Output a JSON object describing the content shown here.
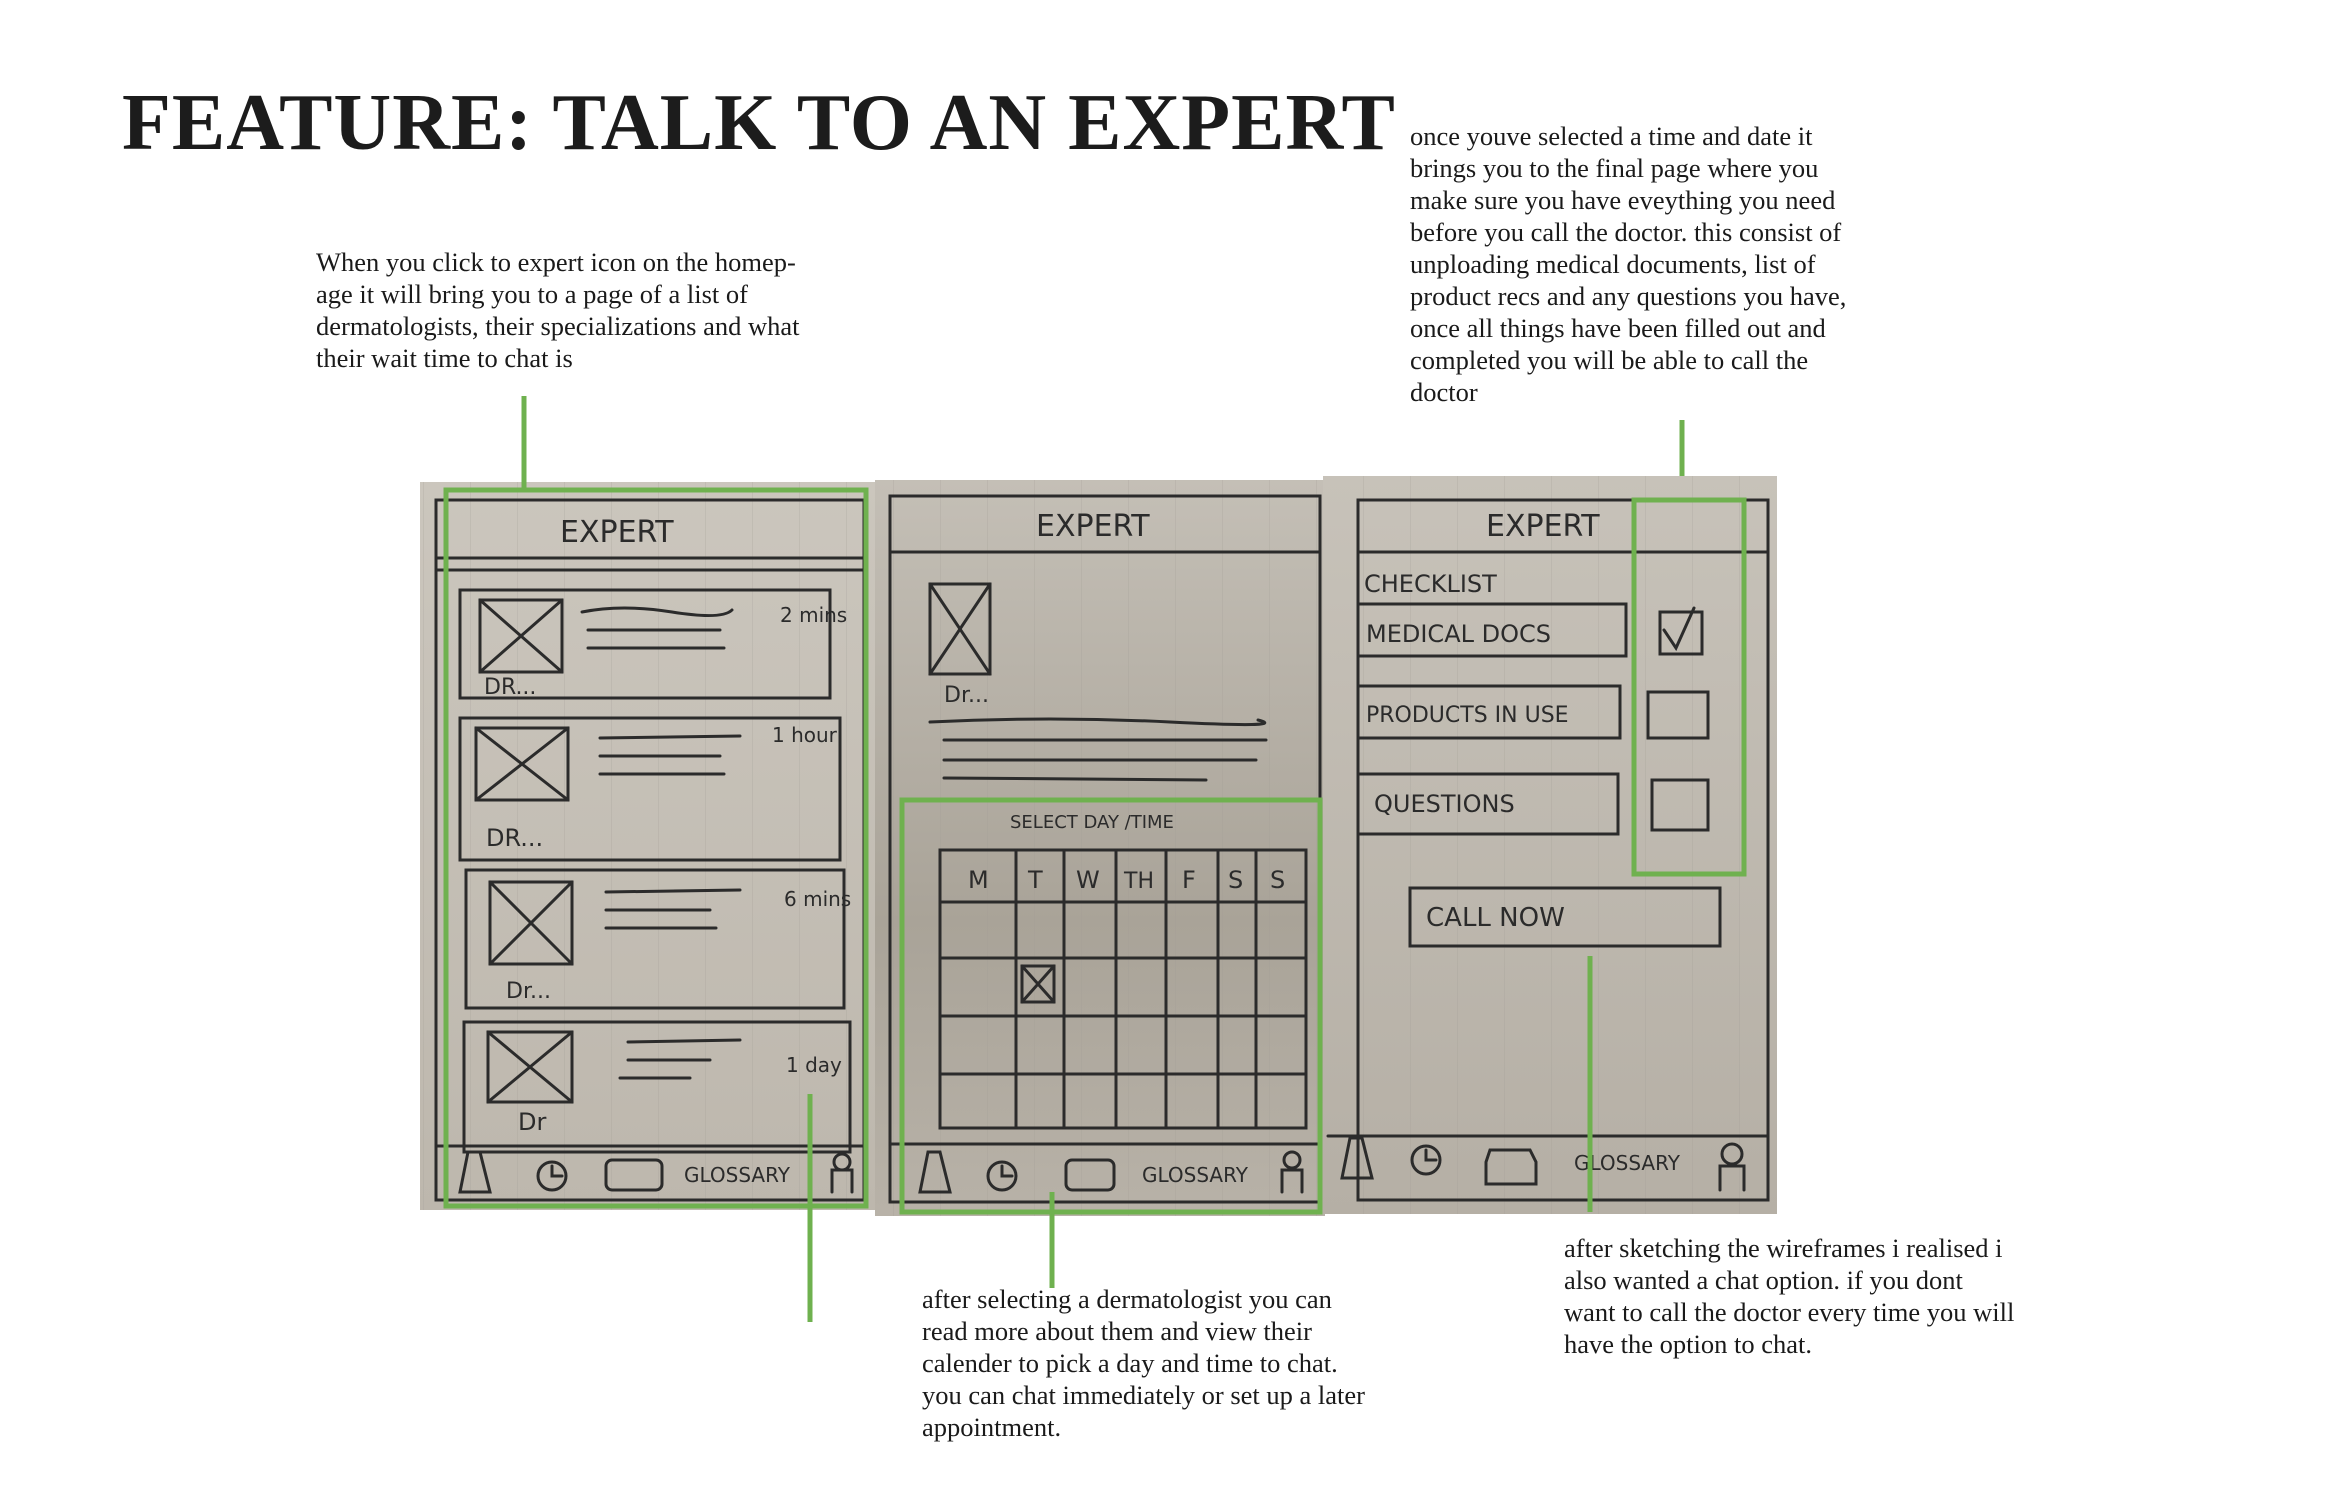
{
  "page": {
    "title": "FEATURE: TALK TO AN EXPERT"
  },
  "notes": {
    "homepage": [
      "When you click to expert icon on the homep-",
      "age it will bring you to a page of a list of",
      "dermatologists, their specializations and what",
      "their wait time to chat is"
    ],
    "checklist": [
      "once youve selected a time and date it",
      "brings you to the final page where  you",
      "make sure you have eveything you need",
      "before you call the doctor. this consist of",
      "unploading medical documents, list of",
      "product recs and any questions you have,",
      "once all things have been filled out and",
      "completed you will be able to call the",
      "doctor"
    ],
    "calendar": [
      "after selecting a dermatologist you can",
      "read more about them and view their",
      "calender to pick a day and time to chat.",
      "you can chat immediately or set up a later",
      "appointment."
    ],
    "chat": [
      "after sketching the wireframes i realised i",
      "also wanted a chat option. if you dont",
      "want to call the doctor every time you will",
      "have the option to chat."
    ]
  },
  "sketch_list": {
    "header": "EXPERT",
    "items": [
      {
        "doctor": "DR...",
        "wait": "2 mins"
      },
      {
        "doctor": "DR...",
        "wait": "1 hour"
      },
      {
        "doctor": "Dr...",
        "wait": "6 mins"
      },
      {
        "doctor": "Dr",
        "wait": "1 day"
      }
    ]
  },
  "sketch_profile": {
    "header": "EXPERT",
    "doctor": "Dr...",
    "picker_label": "SELECT DAY /TIME",
    "days": [
      "M",
      "T",
      "W",
      "TH",
      "F",
      "S",
      "S"
    ]
  },
  "sketch_checklist": {
    "header": "EXPERT",
    "checklist_label": "CHECKLIST",
    "items": [
      {
        "label": "MEDICAL DOCS",
        "checked": true
      },
      {
        "label": "PRODUCTS IN USE",
        "checked": false
      },
      {
        "label": "QUESTIONS",
        "checked": false
      }
    ],
    "call_button": "CALL NOW"
  },
  "tab_bar": {
    "glossary_label": "GLOSSARY"
  },
  "colors": {
    "highlight": "#6fb14f",
    "ink": "#2b2b2b",
    "paper": "#c4bfb6"
  }
}
